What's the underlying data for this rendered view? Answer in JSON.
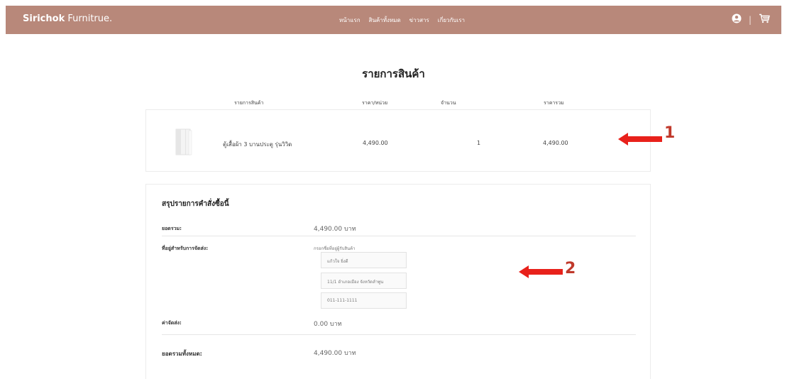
{
  "header": {
    "brand_bold": "Sirichok",
    "brand_rest": " Furnitrue.",
    "nav": [
      "หน้าแรก",
      "สินค้าทั้งหมด",
      "ข่าวสาร",
      "เกี่ยวกับเรา"
    ],
    "separator": "|",
    "icons": [
      "user-icon",
      "cart-icon"
    ],
    "bg_color": "#b8887a"
  },
  "page_title": "รายการสินค้า",
  "table": {
    "headers": [
      "รายการสินค้า",
      "ราคา/หน่วย",
      "จำนวน",
      "ราคารวม"
    ],
    "rows": [
      {
        "name": "ตู้เสื้อผ้า 3 บานประตู รุ่นวิวิด",
        "unit_price": "4,490.00",
        "qty": "1",
        "total": "4,490.00",
        "icon": "wardrobe-image"
      }
    ]
  },
  "summary": {
    "title": "สรุปรายการคำสั่งซื้อนี้",
    "subtotal_label": "ยอดรวม:",
    "subtotal_value": "4,490.00 บาท",
    "address_label": "ที่อยู่สำหรับการจัดส่ง:",
    "address_caption": "กรอกชื่อที่อยู่ผู้รับสินค้า",
    "address_name": "แก้วใจ ยิ่งดี",
    "address_line": "11/1 อำเภอเมือง จังหวัดลำพูน",
    "address_phone": "011-111-1111",
    "shipping_label": "ค่าจัดส่ง:",
    "shipping_value": "0.00 บาท",
    "grand_total_label": "ยอดรวมทั้งหมด:",
    "grand_total_value": "4,490.00 บาท"
  },
  "annotations": [
    {
      "number": "1",
      "color": "#c0392b"
    },
    {
      "number": "2",
      "color": "#c0392b"
    }
  ]
}
